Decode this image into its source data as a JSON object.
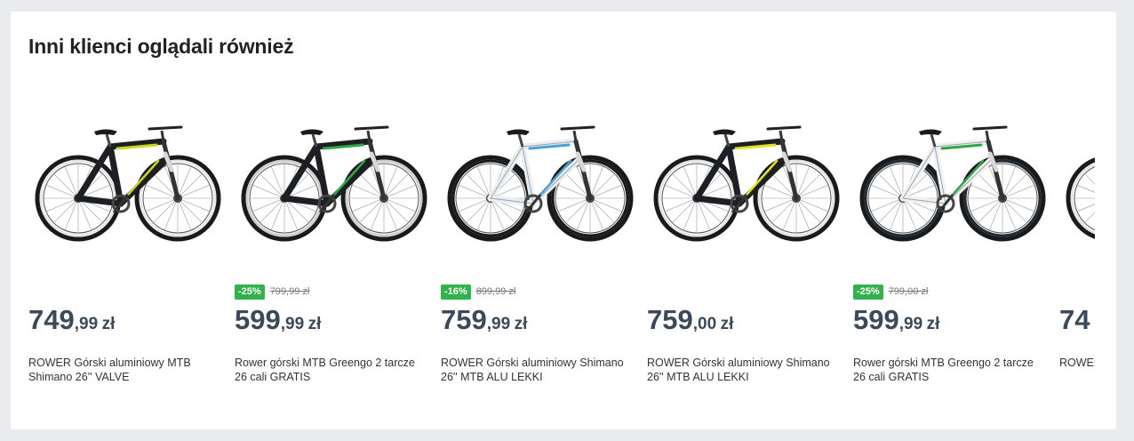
{
  "section": {
    "title": "Inni klienci oglądali również"
  },
  "products": [
    {
      "badge": "",
      "old_price": "",
      "price_int": "749",
      "price_dec": ",99",
      "currency": "zł",
      "name": "ROWER Górski aluminiowy MTB Shimano 26'' VALVE",
      "bike": {
        "frame": "#1c1f24",
        "accent": "#c9d61e",
        "tire": "#e8e8e8"
      }
    },
    {
      "badge": "-25%",
      "old_price": "799,99 zł",
      "price_int": "599",
      "price_dec": ",99",
      "currency": "zł",
      "name": "Rower górski MTB Greengo 2 tarcze 26 cali GRATIS",
      "bike": {
        "frame": "#1c1f24",
        "accent": "#2fa843",
        "tire": "#cfcfcf"
      }
    },
    {
      "badge": "-16%",
      "old_price": "899,99 zł",
      "price_int": "759",
      "price_dec": ",99",
      "currency": "zł",
      "name": "ROWER Górski aluminiowy Shimano 26'' MTB ALU LEKKI",
      "bike": {
        "frame": "#e9eef2",
        "accent": "#4aa3d8",
        "tire": "#1a1a1a"
      }
    },
    {
      "badge": "",
      "old_price": "",
      "price_int": "759",
      "price_dec": ",00",
      "currency": "zł",
      "name": "ROWER Górski aluminiowy Shimano 26'' MTB ALU LEKKI",
      "bike": {
        "frame": "#1c1f24",
        "accent": "#e2e31f",
        "tire": "#e6e6e6"
      }
    },
    {
      "badge": "-25%",
      "old_price": "799,00 zł",
      "price_int": "599",
      "price_dec": ",99",
      "currency": "zł",
      "name": "Rower górski MTB Greengo 2 tarcze 26 cali GRATIS",
      "bike": {
        "frame": "#f2f2f2",
        "accent": "#2fa843",
        "tire": "#1f2a33"
      }
    },
    {
      "badge": "",
      "old_price": "",
      "price_int": "74",
      "price_dec": "",
      "currency": "",
      "name": "ROWER Górski Shima",
      "bike": {
        "frame": "#1c1f24",
        "accent": "#c9d61e",
        "tire": "#e6e6e6"
      }
    }
  ]
}
